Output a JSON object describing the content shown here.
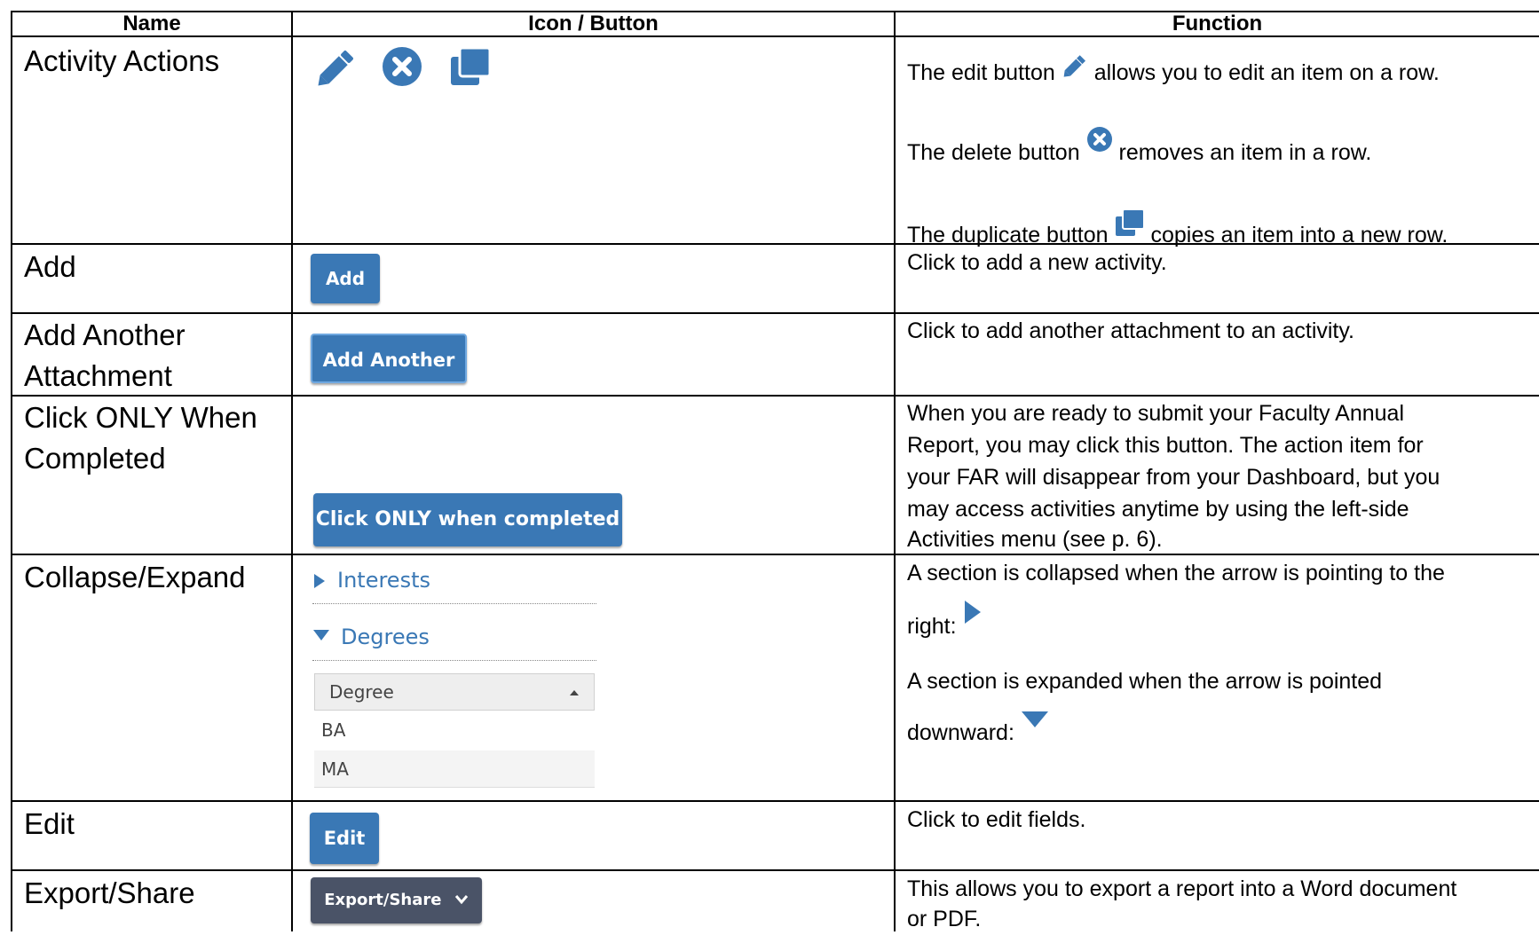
{
  "headers": {
    "name": "Name",
    "icon": "Icon / Button",
    "function": "Function"
  },
  "colors": {
    "primary_button": "#3a78b5",
    "dark_button": "#4a5367",
    "icon_blue": "#3a78b5"
  },
  "rows": {
    "activity_actions": {
      "name": "Activity Actions",
      "icons": [
        "pencil-icon",
        "delete-circle-icon",
        "duplicate-icon"
      ],
      "edit_before": "The edit button ",
      "edit_after": " allows you to edit an item on a row.",
      "delete_before": "The delete button ",
      "delete_after": " removes an item in a row.",
      "duplicate_before": "The duplicate button ",
      "duplicate_after": "copies an item into a new row."
    },
    "add": {
      "name": "Add",
      "button": "Add",
      "function": "Click to add a new activity."
    },
    "add_another": {
      "name_line1": "Add Another",
      "name_line2": "Attachment",
      "button": "Add Another",
      "function": "Click to add another attachment to an activity."
    },
    "click_only": {
      "name_line1": "Click ONLY When",
      "name_line2": "Completed",
      "button": "Click ONLY when completed",
      "function_lines": [
        "When you are ready to submit your Faculty Annual",
        "Report, you may click this button.  The action item for",
        "your FAR will disappear from your Dashboard, but you",
        "may access activities anytime by using the left-side",
        "Activities menu (see p. 6)."
      ]
    },
    "collapse_expand": {
      "name": "Collapse/Expand",
      "collapsed_label": "Interests",
      "expanded_label": "Degrees",
      "dropdown_header": "Degree",
      "options": [
        "BA",
        "MA"
      ],
      "collapsed_line1": "A section is collapsed when the arrow is pointing to the",
      "collapsed_line2": "right: ",
      "expanded_line1": "A section is expanded when the arrow is pointed",
      "expanded_line2": "downward: "
    },
    "edit": {
      "name": "Edit",
      "button": "Edit",
      "function": "Click to edit fields."
    },
    "export_share": {
      "name": "Export/Share",
      "button": "Export/Share",
      "function_line1": "This allows you to export a report into a Word document",
      "function_line2": "or PDF."
    }
  }
}
